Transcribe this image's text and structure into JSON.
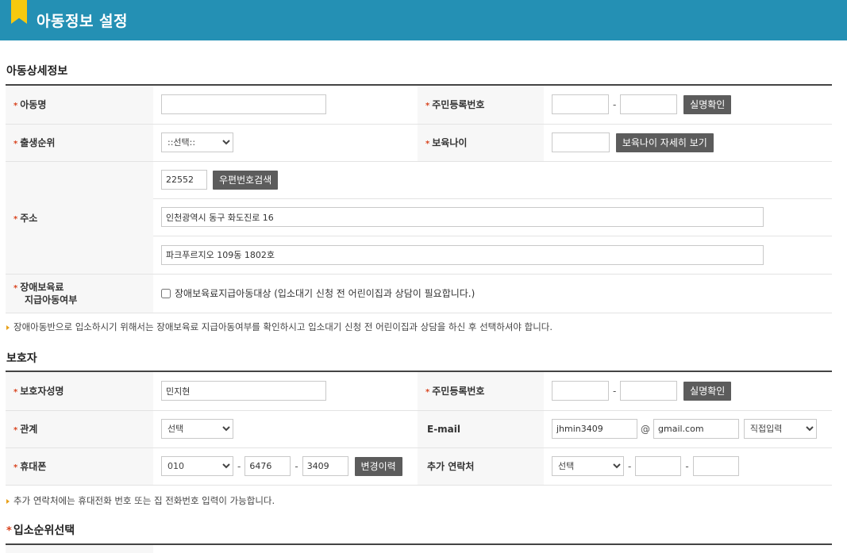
{
  "header": {
    "title": "아동정보 설정"
  },
  "section_child": {
    "title": "아동상세정보",
    "name_label": "아동명",
    "rrn_label": "주민등록번호",
    "rrn_button": "실명확인",
    "birth_order_label": "출생순위",
    "birth_order_value": "::선택::",
    "care_age_label": "보육나이",
    "care_age_button": "보육나이 자세히 보기",
    "address_label": "주소",
    "postcode": "22552",
    "postcode_button": "우편번호검색",
    "address1": "인천광역시 동구 화도진로 16",
    "address2": "파크푸르지오 109동 1802호",
    "disability_label_1": "장애보육료",
    "disability_label_2": "지급아동여부",
    "disability_checkbox": "장애보육료지급아동대상 (입소대기 신청 전 어린이집과 상담이 필요합니다.)",
    "note": "장애아동반으로 입소하시기 위해서는 장애보육료 지급아동여부를 확인하시고 입소대기 신청 전 어린이집과 상담을 하신 후 선택하셔야 합니다."
  },
  "section_guardian": {
    "title": "보호자",
    "name_label": "보호자성명",
    "name_value": "민지현",
    "rrn_label": "주민등록번호",
    "rrn_button": "실명확인",
    "relation_label": "관계",
    "relation_value": "선택",
    "email_label": "E-mail",
    "email_id": "jhmin3409",
    "email_at": "@",
    "email_domain": "gmail.com",
    "email_select": "직접입력",
    "phone_label": "휴대폰",
    "phone_prefix": "010",
    "phone_mid": "6476",
    "phone_last": "3409",
    "phone_button": "변경이력",
    "extra_label": "추가 연락처",
    "extra_select": "선택",
    "note": "추가 연락처에는 휴대전화 번호 또는 집 전화번호 입력이 가능합니다."
  },
  "section_order": {
    "title": "입소순위선택"
  },
  "symbols": {
    "required_mark": "*",
    "dash": "-"
  },
  "colors": {
    "header_bg": "#2490b4",
    "bookmark": "#f6c90f",
    "required": "#d9441f",
    "button_bg": "#5c5c5c"
  }
}
